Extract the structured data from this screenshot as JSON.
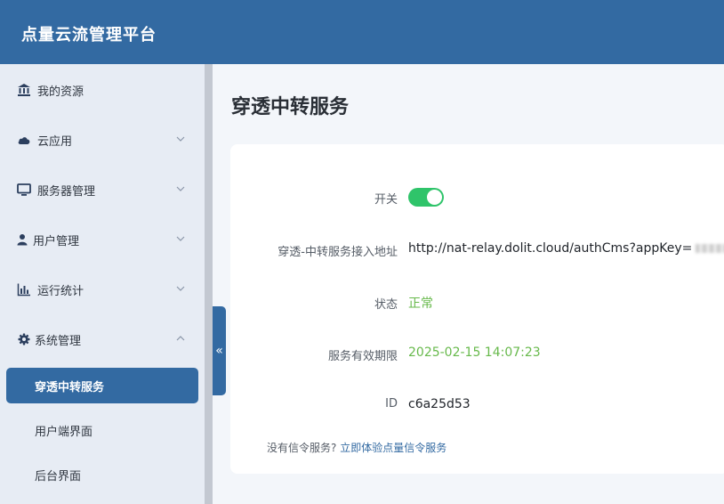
{
  "app": {
    "brand": "点量云流管理平台"
  },
  "sidebar": {
    "items": [
      {
        "label": "我的资源",
        "icon": "bank-icon"
      },
      {
        "label": "云应用",
        "icon": "cloud-icon"
      },
      {
        "label": "服务器管理",
        "icon": "monitor-icon"
      },
      {
        "label": "用户管理",
        "icon": "user-icon"
      },
      {
        "label": "运行统计",
        "icon": "bar-chart-icon"
      },
      {
        "label": "系统管理",
        "icon": "gear-icon"
      }
    ],
    "sub_items": [
      {
        "label": "穿透中转服务",
        "active": true
      },
      {
        "label": "用户端界面",
        "active": false
      },
      {
        "label": "后台界面",
        "active": false
      }
    ],
    "collapse_glyph": "«"
  },
  "page": {
    "title": "穿透中转服务"
  },
  "form": {
    "switch_label": "开关",
    "switch_on": true,
    "address_label": "穿透-中转服务接入地址",
    "address_value": "http://nat-relay.dolit.cloud/authCms?appKey=",
    "status_label": "状态",
    "status_value": "正常",
    "expiry_label": "服务有效期限",
    "expiry_value": "2025-02-15 14:07:23",
    "id_label": "ID",
    "id_value": "c6a25d53"
  },
  "tip": {
    "text": "没有信令服务?",
    "link": "立即体验点量信令服务"
  },
  "colors": {
    "brand": "#336aa2",
    "toggle_on": "#2fc46a",
    "status_ok": "#67b94b"
  }
}
